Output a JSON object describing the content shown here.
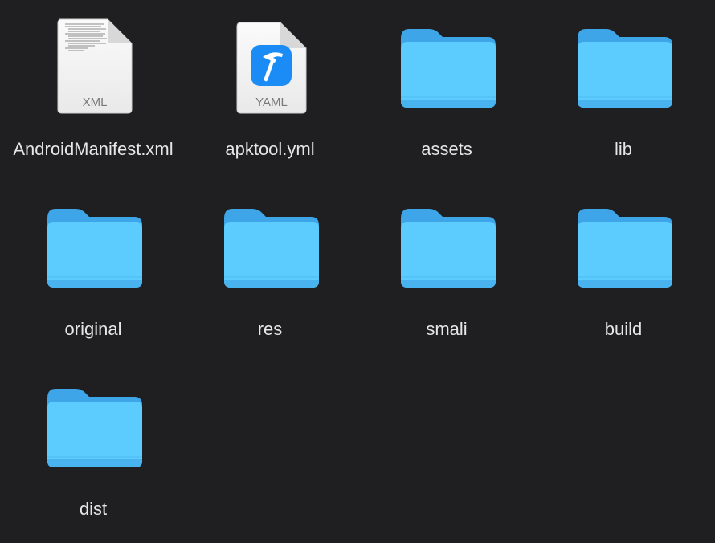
{
  "window": {
    "background": "#1f1f21"
  },
  "colors": {
    "folder_front": "#5ccbfd",
    "folder_back": "#3ea6e8",
    "folder_shade": "#48b3ef",
    "doc_paper": "#f4f4f4",
    "doc_fold": "#d9d9d9",
    "doc_badge_text": "#7a7a7a",
    "xcode_blue": "#1b8cf6",
    "label_text": "#e6e6e6"
  },
  "items": [
    {
      "name": "AndroidManifest.xml",
      "kind": "file",
      "icon": "xml-document-icon",
      "badge": "XML"
    },
    {
      "name": "apktool.yml",
      "kind": "file",
      "icon": "yaml-document-icon",
      "badge": "YAML"
    },
    {
      "name": "assets",
      "kind": "folder",
      "icon": "folder-icon"
    },
    {
      "name": "lib",
      "kind": "folder",
      "icon": "folder-icon"
    },
    {
      "name": "original",
      "kind": "folder",
      "icon": "folder-icon"
    },
    {
      "name": "res",
      "kind": "folder",
      "icon": "folder-icon"
    },
    {
      "name": "smali",
      "kind": "folder",
      "icon": "folder-icon"
    },
    {
      "name": "build",
      "kind": "folder",
      "icon": "folder-icon"
    },
    {
      "name": "dist",
      "kind": "folder",
      "icon": "folder-icon"
    }
  ]
}
